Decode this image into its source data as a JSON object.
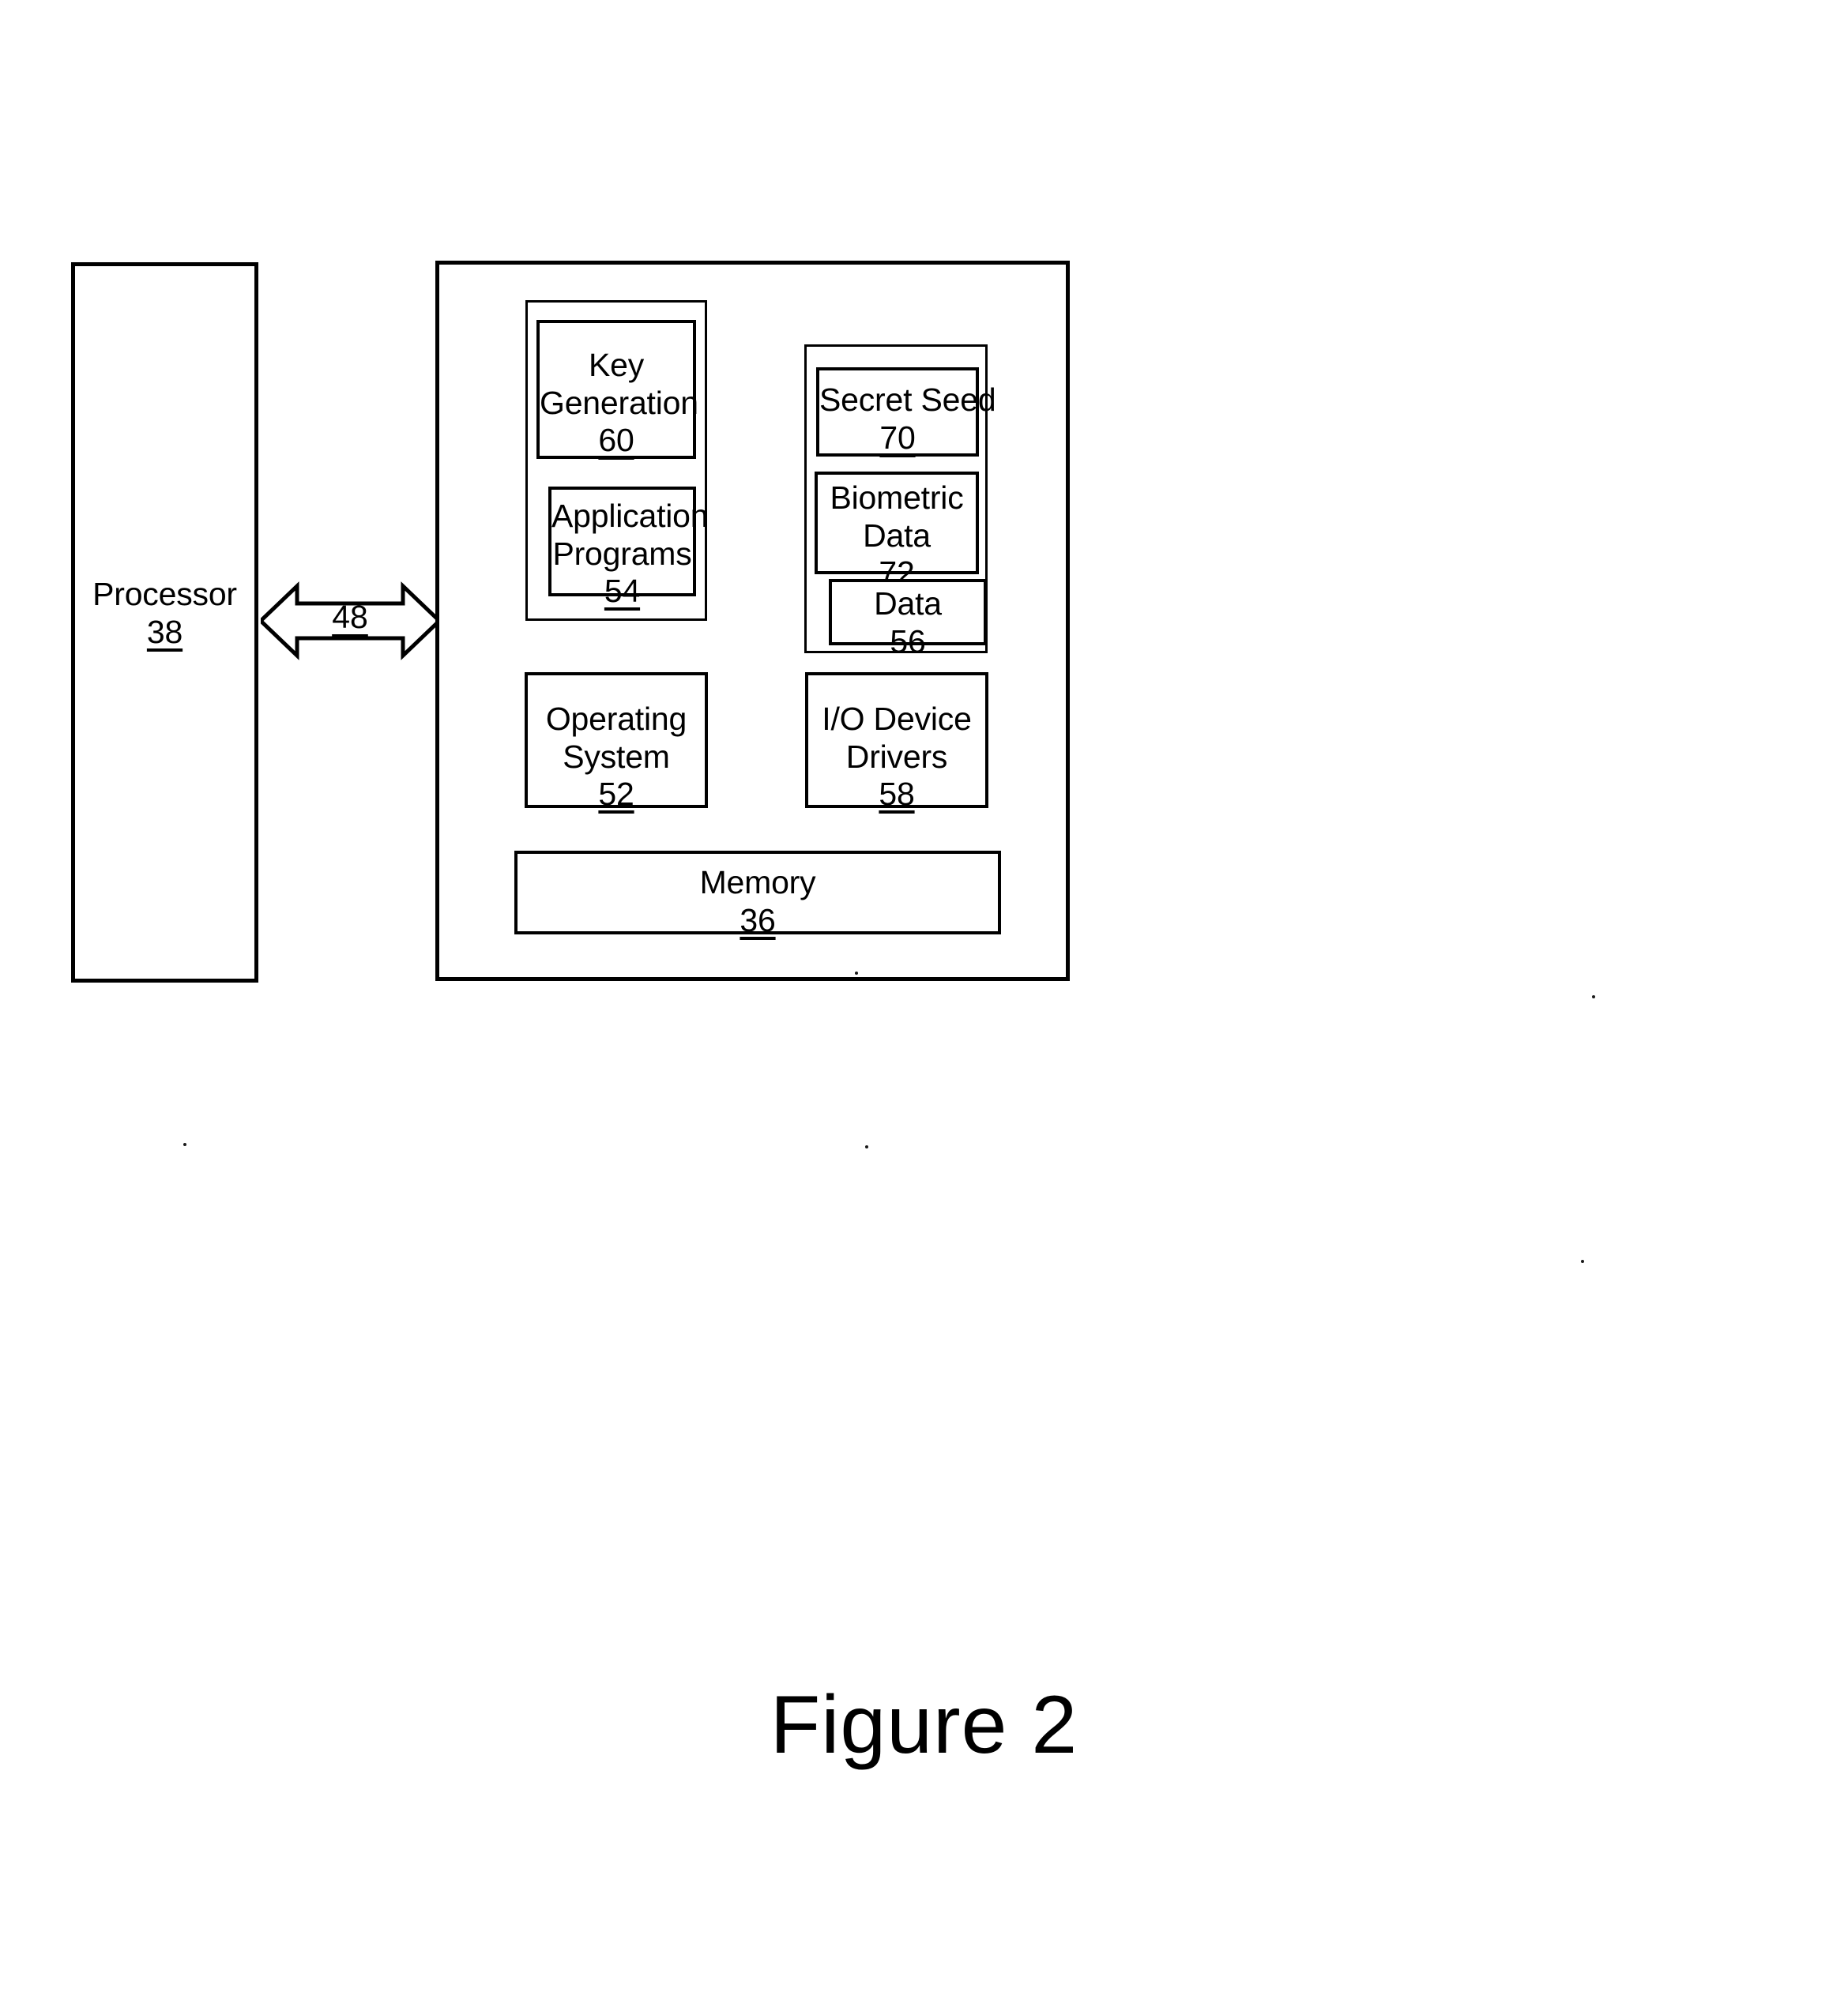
{
  "figure": {
    "caption": "Figure 2"
  },
  "processor": {
    "label": "Processor",
    "ref": "38"
  },
  "bus": {
    "ref": "48",
    "icon": "double-headed-arrow-icon"
  },
  "memory_block": {
    "programs_group": {
      "key_generation": {
        "label_line1": "Key",
        "label_line2": "Generation",
        "ref": "60"
      },
      "application_programs": {
        "label_line1": "Application",
        "label_line2": "Programs",
        "ref": "54"
      }
    },
    "data_group": {
      "secret_seed": {
        "label": "Secret Seed",
        "ref": "70"
      },
      "biometric_data": {
        "label_line1": "Biometric",
        "label_line2": "Data",
        "ref": "72"
      },
      "data": {
        "label": "Data",
        "ref": "56"
      }
    },
    "operating_system": {
      "label_line1": "Operating",
      "label_line2": "System",
      "ref": "52"
    },
    "io_device_drivers": {
      "label_line1": "I/O Device",
      "label_line2": "Drivers",
      "ref": "58"
    },
    "memory": {
      "label": "Memory",
      "ref": "36"
    }
  },
  "colors": {
    "ink": "#000000",
    "paper": "#ffffff"
  }
}
